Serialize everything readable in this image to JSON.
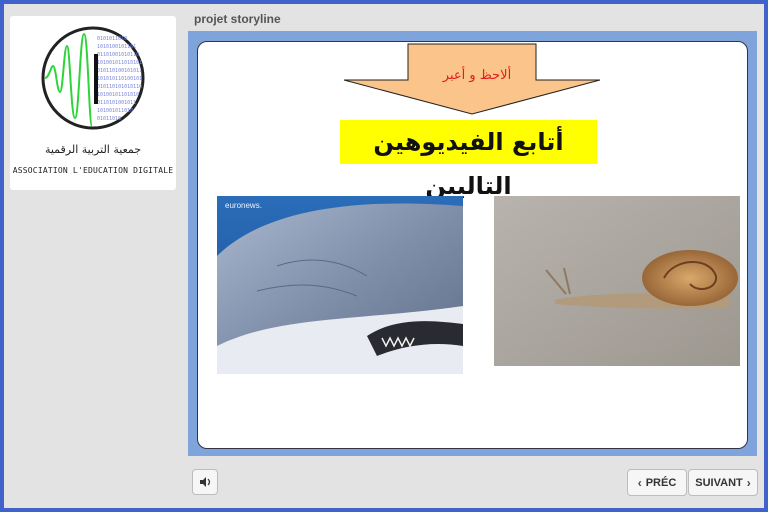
{
  "sidebar": {
    "logo": {
      "arabic_text": "جمعية التربية الرقمية",
      "french_text": "ASSOCIATION L'EDUCATION DIGITALE"
    }
  },
  "header": {
    "title": "projet storyline"
  },
  "slide": {
    "callout_text": "ألاحظ و أعبر",
    "headline": "أتابع الفيديوهين التاليين",
    "video_left": {
      "watermark": "euronews."
    }
  },
  "controls": {
    "prev_label": "PRÉC",
    "next_label": "SUIVANT"
  },
  "colors": {
    "outer_border": "#3f63c9",
    "slide_border": "#7fa3db",
    "callout_fill": "#fbc48a",
    "callout_text": "#e01e1e",
    "highlight": "#ffff00"
  }
}
